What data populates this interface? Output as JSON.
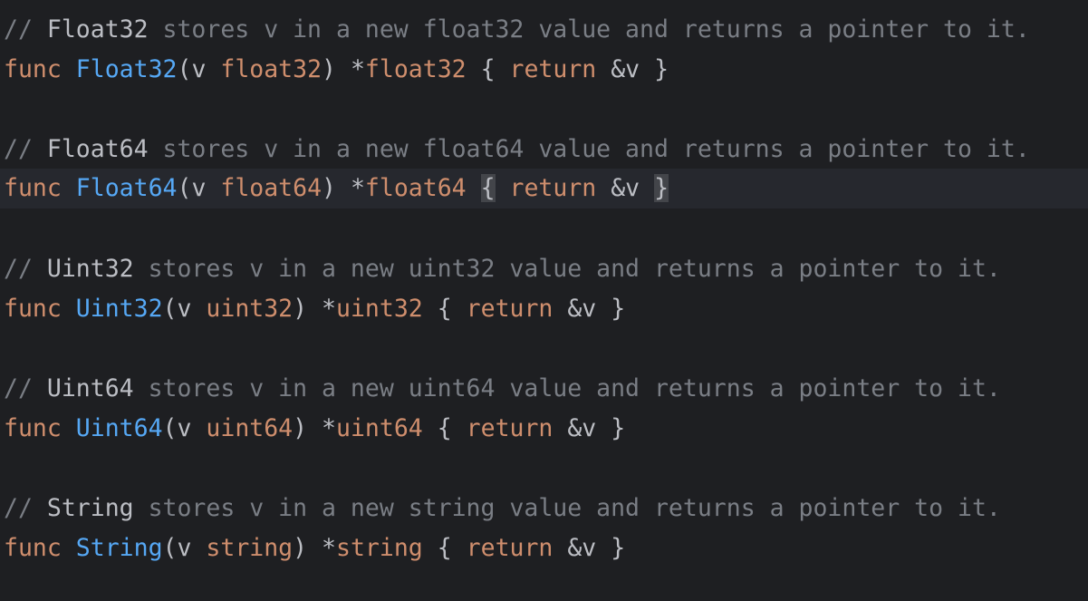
{
  "colors": {
    "background": "#1e1f22",
    "current_line": "#26282e",
    "comment": "#7a7e85",
    "keyword": "#cf8e6d",
    "function_name": "#56a8f5",
    "text": "#bcbec4",
    "brace_match": "#43454a"
  },
  "blocks": [
    {
      "comment": {
        "prefix": "// ",
        "ident": "Float32",
        "rest": " stores v in a new float32 value and returns a pointer to it."
      },
      "code": {
        "kw": "func",
        "name": "Float32",
        "open": "(v ",
        "param_type": "float32",
        "close": ") *",
        "ret_type": "float32",
        "lbrace": "{",
        "kw2": "return",
        "body": " &v ",
        "rbrace": "}"
      }
    },
    {
      "comment": {
        "prefix": "// ",
        "ident": "Float64",
        "rest": " stores v in a new float64 value and returns a pointer to it."
      },
      "code": {
        "kw": "func",
        "name": "Float64",
        "open": "(v ",
        "param_type": "float64",
        "close": ") *",
        "ret_type": "float64",
        "lbrace": "{",
        "kw2": "return",
        "body": " &v ",
        "rbrace": "}"
      }
    },
    {
      "comment": {
        "prefix": "// ",
        "ident": "Uint32",
        "rest": " stores v in a new uint32 value and returns a pointer to it."
      },
      "code": {
        "kw": "func",
        "name": "Uint32",
        "open": "(v ",
        "param_type": "uint32",
        "close": ") *",
        "ret_type": "uint32",
        "lbrace": "{",
        "kw2": "return",
        "body": " &v ",
        "rbrace": "}"
      }
    },
    {
      "comment": {
        "prefix": "// ",
        "ident": "Uint64",
        "rest": " stores v in a new uint64 value and returns a pointer to it."
      },
      "code": {
        "kw": "func",
        "name": "Uint64",
        "open": "(v ",
        "param_type": "uint64",
        "close": ") *",
        "ret_type": "uint64",
        "lbrace": "{",
        "kw2": "return",
        "body": " &v ",
        "rbrace": "}"
      }
    },
    {
      "comment": {
        "prefix": "// ",
        "ident": "String",
        "rest": " stores v in a new string value and returns a pointer to it."
      },
      "code": {
        "kw": "func",
        "name": "String",
        "open": "(v ",
        "param_type": "string",
        "close": ") *",
        "ret_type": "string",
        "lbrace": "{",
        "kw2": "return",
        "body": " &v ",
        "rbrace": "}"
      }
    }
  ]
}
